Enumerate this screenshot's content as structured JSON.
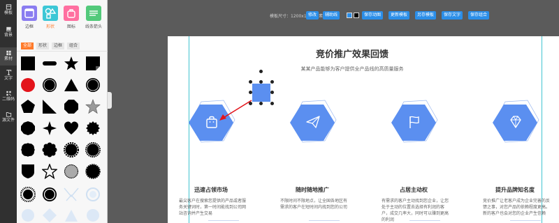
{
  "rail": {
    "items": [
      {
        "label": "模板",
        "icon": "template-icon"
      },
      {
        "label": "背景",
        "icon": "background-icon"
      },
      {
        "label": "素材",
        "icon": "material-icon"
      },
      {
        "label": "文字",
        "icon": "text-icon"
      },
      {
        "label": "二维码",
        "icon": "qrcode-icon"
      },
      {
        "label": "源文件",
        "icon": "source-file-icon"
      }
    ]
  },
  "panel": {
    "categories": [
      {
        "label": "边框",
        "color": "#8a7cf0",
        "icon": "frame-icon"
      },
      {
        "label": "形状",
        "color": "#3cc7d6",
        "icon": "shape-icon"
      },
      {
        "label": "图标",
        "color": "#ff6fa0",
        "icon": "icon-icon"
      },
      {
        "label": "线条箭头",
        "color": "#52c97a",
        "icon": "line-arrow-icon"
      }
    ],
    "tabs": [
      "全部",
      "形状",
      "边框",
      "组合"
    ]
  },
  "toolbar": {
    "size_label": "模板尺寸：1200x1000像素",
    "modify": "修改",
    "guide": "辅助线",
    "colors": [
      "#2b8ee8",
      "#000000"
    ],
    "save_anim": "保存动图",
    "more_templates": "更新模板",
    "save_as_template": "另存模板",
    "save_text": "保存文字",
    "save_combo": "保存组合"
  },
  "canvas": {
    "title": "竞价推广效果回馈",
    "subtitle": "某某产品能够为客户提供全产品线的高质量服务",
    "accent": "#5b8ff0",
    "features": [
      {
        "title": "迅速占领市场",
        "icon": "shopping-bag-icon",
        "desc": "最尖客户在搜索您提供的产品或者服务关键词时，第一时间能找到公司网站咨询并产生交易"
      },
      {
        "title": "随时随地推广",
        "icon": "paper-plane-icon",
        "desc": "不限时间不限地点，让全国各地区有需求的客户在短时间内找到您的公司"
      },
      {
        "title": "占居主动权",
        "icon": "flag-icon",
        "desc": "有需求的客户主动找到您企业，让您处于主动的位置去选择有利润的客户，成交几率大，同时可以赚到更高的利润"
      },
      {
        "title": "提升品牌知名度",
        "icon": "diamond-icon",
        "desc": "竞价推广让老客户成为企业完善的反馈之事，对您产品的依赖程度更高。新的客户也会对您的企业产生信赖"
      }
    ]
  }
}
